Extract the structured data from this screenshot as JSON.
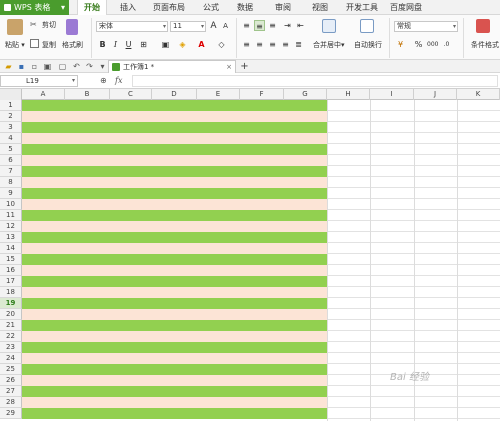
{
  "menu": {
    "app_button": "WPS 表格",
    "tabs": [
      "开始",
      "插入",
      "页面布局",
      "公式",
      "数据",
      "审阅",
      "视图",
      "开发工具",
      "百度网盘"
    ],
    "active_tab": "开始"
  },
  "ribbon": {
    "paste": "粘贴",
    "cut": "剪切",
    "copy": "复制",
    "format_painter": "格式刷",
    "font_name": "宋体",
    "font_size": "11",
    "bold": "B",
    "italic": "I",
    "underline": "U",
    "merge_center": "合并居中",
    "wrap_text": "自动换行",
    "number_format": "常规",
    "percent": "%",
    "conditional_format": "条件格式"
  },
  "quickbar": {
    "doc_tab": "工作簿1 *",
    "add_tab": "+"
  },
  "formula_bar": {
    "cell_ref": "L19",
    "fx_label": "fx",
    "formula": ""
  },
  "grid": {
    "columns": [
      "A",
      "B",
      "C",
      "D",
      "E",
      "F",
      "G",
      "H",
      "I",
      "J",
      "K"
    ],
    "rows": [
      "1",
      "2",
      "3",
      "4",
      "5",
      "6",
      "7",
      "8",
      "9",
      "10",
      "11",
      "12",
      "13",
      "14",
      "15",
      "16",
      "17",
      "18",
      "19",
      "20",
      "21",
      "22",
      "23",
      "24",
      "25",
      "26",
      "27",
      "28",
      "29"
    ],
    "selected_row": "19",
    "band_colors": {
      "odd": "#92d050",
      "even": "#fce4d6"
    },
    "fill_range": "A1:G29"
  },
  "colors": {
    "accent": "#4a9c2d",
    "green_band": "#92d050",
    "peach_band": "#fce4d6"
  },
  "watermark": "Bai 经验"
}
